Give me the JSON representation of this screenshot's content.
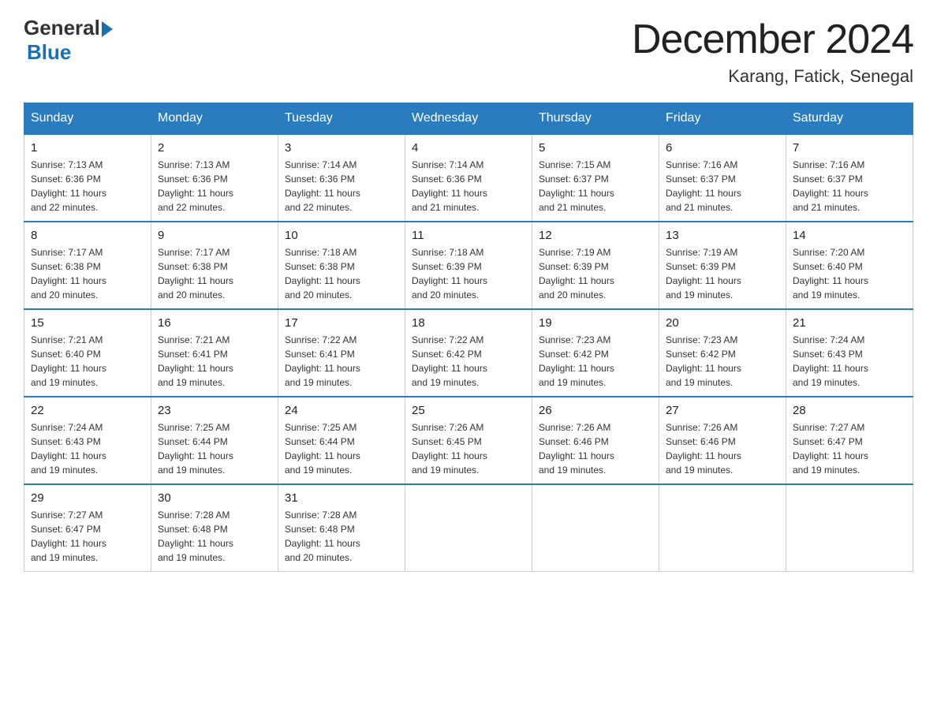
{
  "header": {
    "logo_general": "General",
    "logo_blue": "Blue",
    "title": "December 2024",
    "subtitle": "Karang, Fatick, Senegal"
  },
  "days_of_week": [
    "Sunday",
    "Monday",
    "Tuesday",
    "Wednesday",
    "Thursday",
    "Friday",
    "Saturday"
  ],
  "weeks": [
    [
      {
        "day": "1",
        "sunrise": "7:13 AM",
        "sunset": "6:36 PM",
        "daylight": "11 hours and 22 minutes."
      },
      {
        "day": "2",
        "sunrise": "7:13 AM",
        "sunset": "6:36 PM",
        "daylight": "11 hours and 22 minutes."
      },
      {
        "day": "3",
        "sunrise": "7:14 AM",
        "sunset": "6:36 PM",
        "daylight": "11 hours and 22 minutes."
      },
      {
        "day": "4",
        "sunrise": "7:14 AM",
        "sunset": "6:36 PM",
        "daylight": "11 hours and 21 minutes."
      },
      {
        "day": "5",
        "sunrise": "7:15 AM",
        "sunset": "6:37 PM",
        "daylight": "11 hours and 21 minutes."
      },
      {
        "day": "6",
        "sunrise": "7:16 AM",
        "sunset": "6:37 PM",
        "daylight": "11 hours and 21 minutes."
      },
      {
        "day": "7",
        "sunrise": "7:16 AM",
        "sunset": "6:37 PM",
        "daylight": "11 hours and 21 minutes."
      }
    ],
    [
      {
        "day": "8",
        "sunrise": "7:17 AM",
        "sunset": "6:38 PM",
        "daylight": "11 hours and 20 minutes."
      },
      {
        "day": "9",
        "sunrise": "7:17 AM",
        "sunset": "6:38 PM",
        "daylight": "11 hours and 20 minutes."
      },
      {
        "day": "10",
        "sunrise": "7:18 AM",
        "sunset": "6:38 PM",
        "daylight": "11 hours and 20 minutes."
      },
      {
        "day": "11",
        "sunrise": "7:18 AM",
        "sunset": "6:39 PM",
        "daylight": "11 hours and 20 minutes."
      },
      {
        "day": "12",
        "sunrise": "7:19 AM",
        "sunset": "6:39 PM",
        "daylight": "11 hours and 20 minutes."
      },
      {
        "day": "13",
        "sunrise": "7:19 AM",
        "sunset": "6:39 PM",
        "daylight": "11 hours and 19 minutes."
      },
      {
        "day": "14",
        "sunrise": "7:20 AM",
        "sunset": "6:40 PM",
        "daylight": "11 hours and 19 minutes."
      }
    ],
    [
      {
        "day": "15",
        "sunrise": "7:21 AM",
        "sunset": "6:40 PM",
        "daylight": "11 hours and 19 minutes."
      },
      {
        "day": "16",
        "sunrise": "7:21 AM",
        "sunset": "6:41 PM",
        "daylight": "11 hours and 19 minutes."
      },
      {
        "day": "17",
        "sunrise": "7:22 AM",
        "sunset": "6:41 PM",
        "daylight": "11 hours and 19 minutes."
      },
      {
        "day": "18",
        "sunrise": "7:22 AM",
        "sunset": "6:42 PM",
        "daylight": "11 hours and 19 minutes."
      },
      {
        "day": "19",
        "sunrise": "7:23 AM",
        "sunset": "6:42 PM",
        "daylight": "11 hours and 19 minutes."
      },
      {
        "day": "20",
        "sunrise": "7:23 AM",
        "sunset": "6:42 PM",
        "daylight": "11 hours and 19 minutes."
      },
      {
        "day": "21",
        "sunrise": "7:24 AM",
        "sunset": "6:43 PM",
        "daylight": "11 hours and 19 minutes."
      }
    ],
    [
      {
        "day": "22",
        "sunrise": "7:24 AM",
        "sunset": "6:43 PM",
        "daylight": "11 hours and 19 minutes."
      },
      {
        "day": "23",
        "sunrise": "7:25 AM",
        "sunset": "6:44 PM",
        "daylight": "11 hours and 19 minutes."
      },
      {
        "day": "24",
        "sunrise": "7:25 AM",
        "sunset": "6:44 PM",
        "daylight": "11 hours and 19 minutes."
      },
      {
        "day": "25",
        "sunrise": "7:26 AM",
        "sunset": "6:45 PM",
        "daylight": "11 hours and 19 minutes."
      },
      {
        "day": "26",
        "sunrise": "7:26 AM",
        "sunset": "6:46 PM",
        "daylight": "11 hours and 19 minutes."
      },
      {
        "day": "27",
        "sunrise": "7:26 AM",
        "sunset": "6:46 PM",
        "daylight": "11 hours and 19 minutes."
      },
      {
        "day": "28",
        "sunrise": "7:27 AM",
        "sunset": "6:47 PM",
        "daylight": "11 hours and 19 minutes."
      }
    ],
    [
      {
        "day": "29",
        "sunrise": "7:27 AM",
        "sunset": "6:47 PM",
        "daylight": "11 hours and 19 minutes."
      },
      {
        "day": "30",
        "sunrise": "7:28 AM",
        "sunset": "6:48 PM",
        "daylight": "11 hours and 19 minutes."
      },
      {
        "day": "31",
        "sunrise": "7:28 AM",
        "sunset": "6:48 PM",
        "daylight": "11 hours and 20 minutes."
      },
      null,
      null,
      null,
      null
    ]
  ],
  "labels": {
    "sunrise": "Sunrise:",
    "sunset": "Sunset:",
    "daylight": "Daylight:"
  }
}
